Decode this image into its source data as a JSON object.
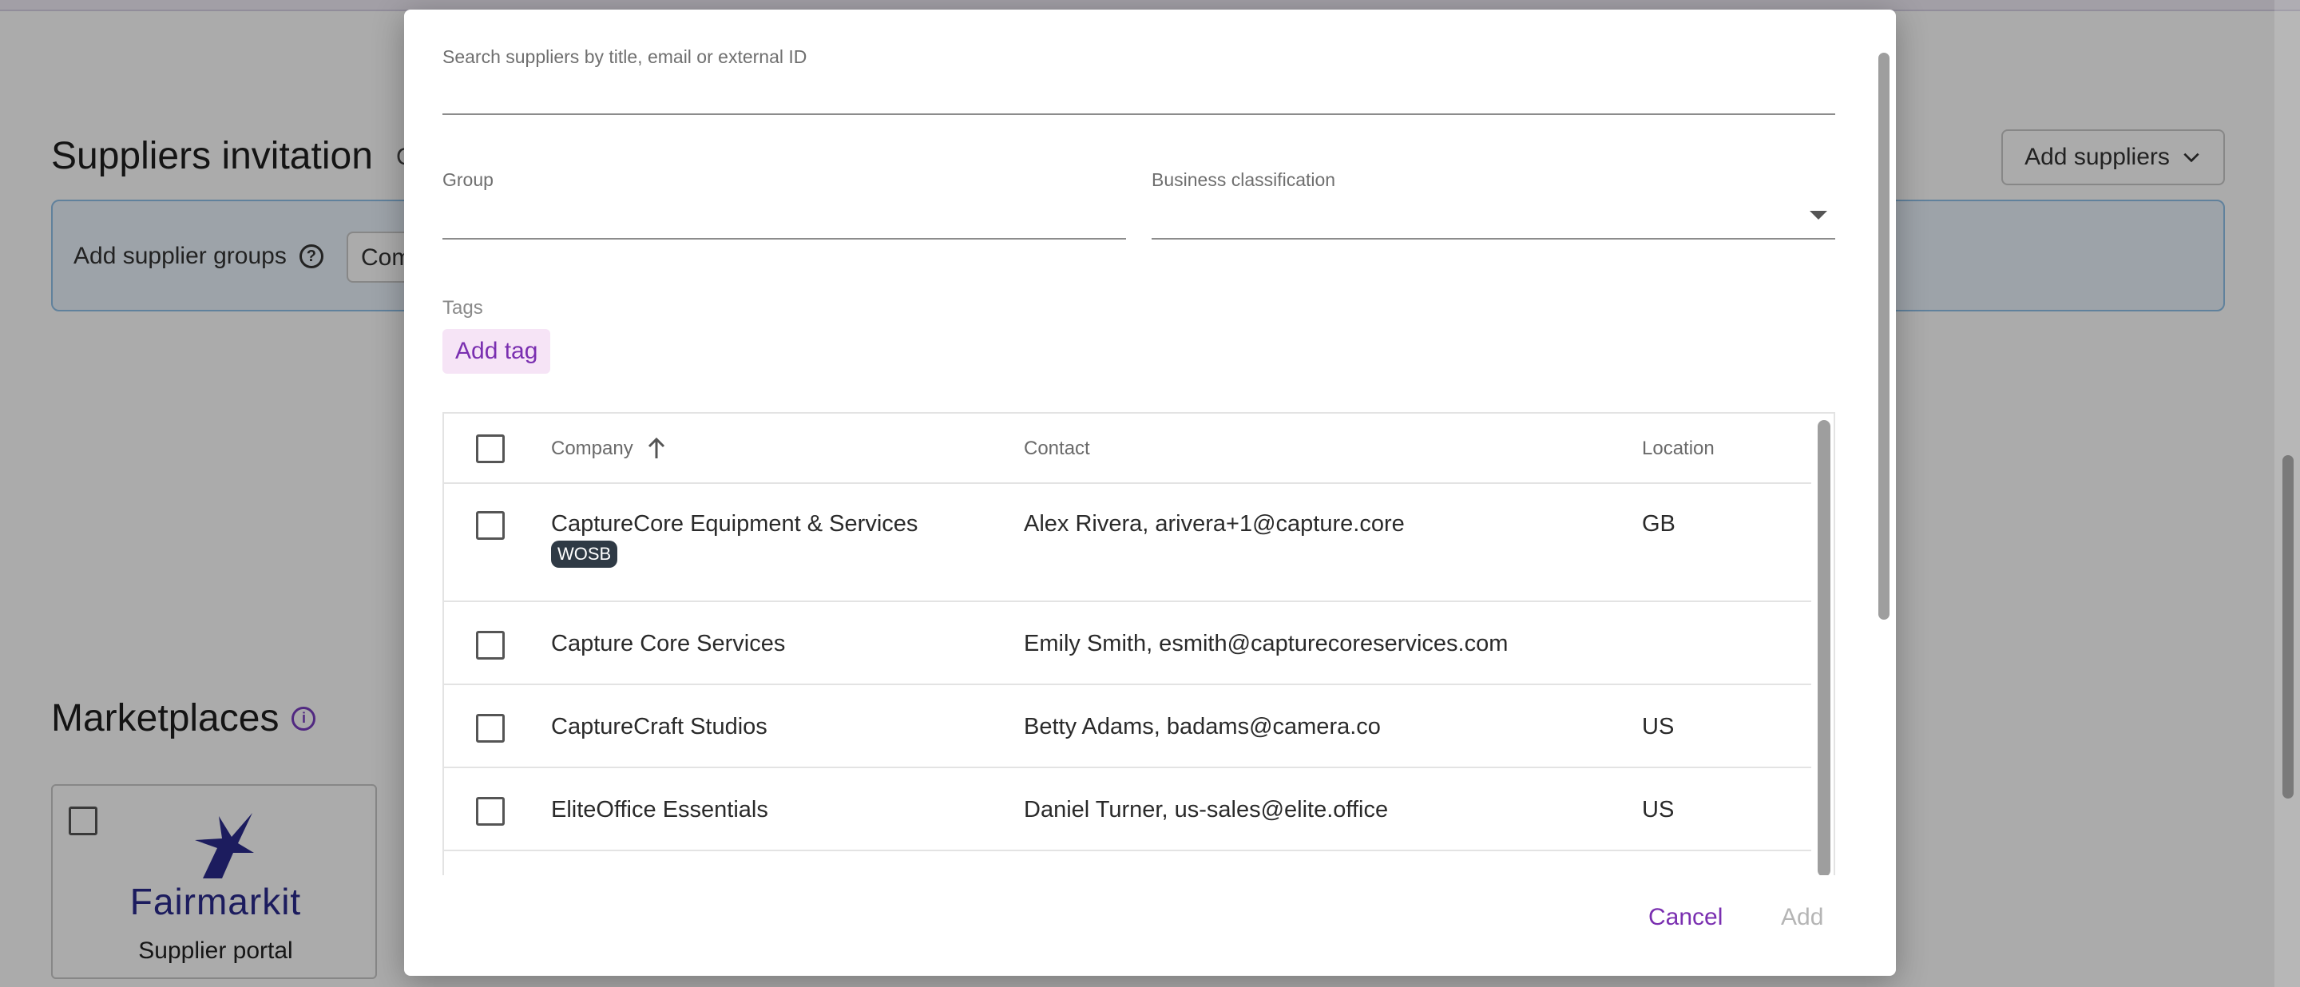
{
  "background": {
    "section_title": "Suppliers invitation",
    "section_title_cut": "C",
    "add_suppliers_label": "Add suppliers",
    "groups_label": "Add supplier groups",
    "groups_combo_value": "Com",
    "marketplaces_title": "Marketplaces",
    "marketplace_card": {
      "logo_text": "Fairmarkit",
      "label": "Supplier portal"
    }
  },
  "modal": {
    "search": {
      "placeholder": "Search suppliers by title, email or external ID",
      "value": ""
    },
    "group": {
      "label": "Group",
      "value": ""
    },
    "business_classification": {
      "label": "Business classification",
      "value": ""
    },
    "tags": {
      "label": "Tags",
      "add_tag_label": "Add tag"
    },
    "table": {
      "columns": {
        "company": "Company",
        "contact": "Contact",
        "location": "Location"
      },
      "rows": [
        {
          "company": "CaptureCore Equipment & Services",
          "badge": "WOSB",
          "contact": "Alex Rivera, arivera+1@capture.core",
          "location": "GB"
        },
        {
          "company": "Capture Core Services",
          "badge": "",
          "contact": "Emily Smith, esmith@capturecoreservices.com",
          "location": ""
        },
        {
          "company": "CaptureCraft Studios",
          "badge": "",
          "contact": "Betty Adams, badams@camera.co",
          "location": "US"
        },
        {
          "company": "EliteOffice Essentials",
          "badge": "",
          "contact": "Daniel Turner, us-sales@elite.office",
          "location": "US"
        }
      ]
    },
    "actions": {
      "cancel": "Cancel",
      "add": "Add"
    }
  },
  "colors": {
    "accent": "#7a2fb0",
    "badge_bg": "#2f3a45",
    "info_box_bg": "#eaf3fc",
    "info_box_border": "#8fc0e9"
  },
  "icons": {
    "sort": "arrow-up-icon",
    "dropdown": "caret-down-icon",
    "help": "question-circle-icon",
    "info": "info-circle-icon",
    "chevron": "chevron-down-icon"
  }
}
